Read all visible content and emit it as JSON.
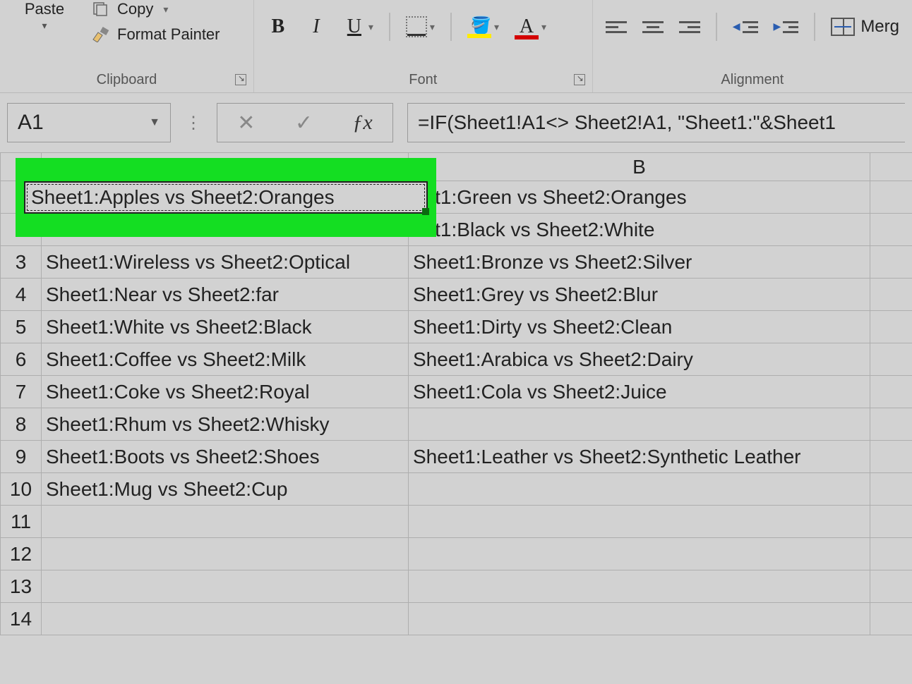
{
  "ribbon": {
    "clipboard": {
      "label": "Clipboard",
      "paste": "Paste",
      "copy": "Copy",
      "format_painter": "Format Painter"
    },
    "font": {
      "label": "Font",
      "bold": "B",
      "italic": "I",
      "underline": "U",
      "font_color_letter": "A"
    },
    "alignment": {
      "label": "Alignment",
      "merge": "Merg"
    }
  },
  "namebox": "A1",
  "formula": "=IF(Sheet1!A1<> Sheet2!A1, \"Sheet1:\"&Sheet1",
  "columns": {
    "A": "",
    "B": "B"
  },
  "highlight_cell": "Sheet1:Apples vs Sheet2:Oranges",
  "rows": [
    {
      "n": "",
      "A": "",
      "B": "eet1:Green vs Sheet2:Oranges"
    },
    {
      "n": "",
      "A": "",
      "B": "eet1:Black vs Sheet2:White"
    },
    {
      "n": "3",
      "A": "Sheet1:Wireless vs Sheet2:Optical",
      "B": "Sheet1:Bronze vs Sheet2:Silver"
    },
    {
      "n": "4",
      "A": "Sheet1:Near vs Sheet2:far",
      "B": "Sheet1:Grey vs Sheet2:Blur"
    },
    {
      "n": "5",
      "A": "Sheet1:White vs Sheet2:Black",
      "B": "Sheet1:Dirty vs Sheet2:Clean"
    },
    {
      "n": "6",
      "A": "Sheet1:Coffee vs Sheet2:Milk",
      "B": "Sheet1:Arabica vs Sheet2:Dairy"
    },
    {
      "n": "7",
      "A": "Sheet1:Coke vs Sheet2:Royal",
      "B": "Sheet1:Cola vs Sheet2:Juice"
    },
    {
      "n": "8",
      "A": "Sheet1:Rhum vs Sheet2:Whisky",
      "B": ""
    },
    {
      "n": "9",
      "A": "Sheet1:Boots vs Sheet2:Shoes",
      "B": "Sheet1:Leather vs Sheet2:Synthetic Leather"
    },
    {
      "n": "10",
      "A": "Sheet1:Mug vs Sheet2:Cup",
      "B": ""
    },
    {
      "n": "11",
      "A": "",
      "B": ""
    },
    {
      "n": "12",
      "A": "",
      "B": ""
    },
    {
      "n": "13",
      "A": "",
      "B": ""
    },
    {
      "n": "14",
      "A": "",
      "B": ""
    }
  ]
}
